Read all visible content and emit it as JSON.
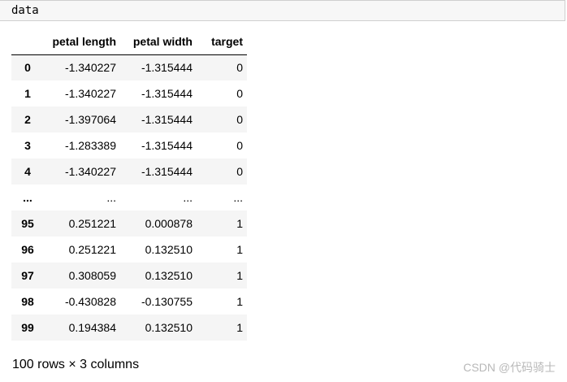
{
  "cell": {
    "code": "data"
  },
  "table": {
    "columns": [
      "",
      "petal length",
      "petal width",
      "target"
    ],
    "rows": [
      {
        "index": "0",
        "petal_length": "-1.340227",
        "petal_width": "-1.315444",
        "target": "0"
      },
      {
        "index": "1",
        "petal_length": "-1.340227",
        "petal_width": "-1.315444",
        "target": "0"
      },
      {
        "index": "2",
        "petal_length": "-1.397064",
        "petal_width": "-1.315444",
        "target": "0"
      },
      {
        "index": "3",
        "petal_length": "-1.283389",
        "petal_width": "-1.315444",
        "target": "0"
      },
      {
        "index": "4",
        "petal_length": "-1.340227",
        "petal_width": "-1.315444",
        "target": "0"
      },
      {
        "index": "...",
        "petal_length": "...",
        "petal_width": "...",
        "target": "..."
      },
      {
        "index": "95",
        "petal_length": "0.251221",
        "petal_width": "0.000878",
        "target": "1"
      },
      {
        "index": "96",
        "petal_length": "0.251221",
        "petal_width": "0.132510",
        "target": "1"
      },
      {
        "index": "97",
        "petal_length": "0.308059",
        "petal_width": "0.132510",
        "target": "1"
      },
      {
        "index": "98",
        "petal_length": "-0.430828",
        "petal_width": "-0.130755",
        "target": "1"
      },
      {
        "index": "99",
        "petal_length": "0.194384",
        "petal_width": "0.132510",
        "target": "1"
      }
    ]
  },
  "shape_text": "100 rows × 3 columns",
  "watermark": "CSDN @代码骑士"
}
